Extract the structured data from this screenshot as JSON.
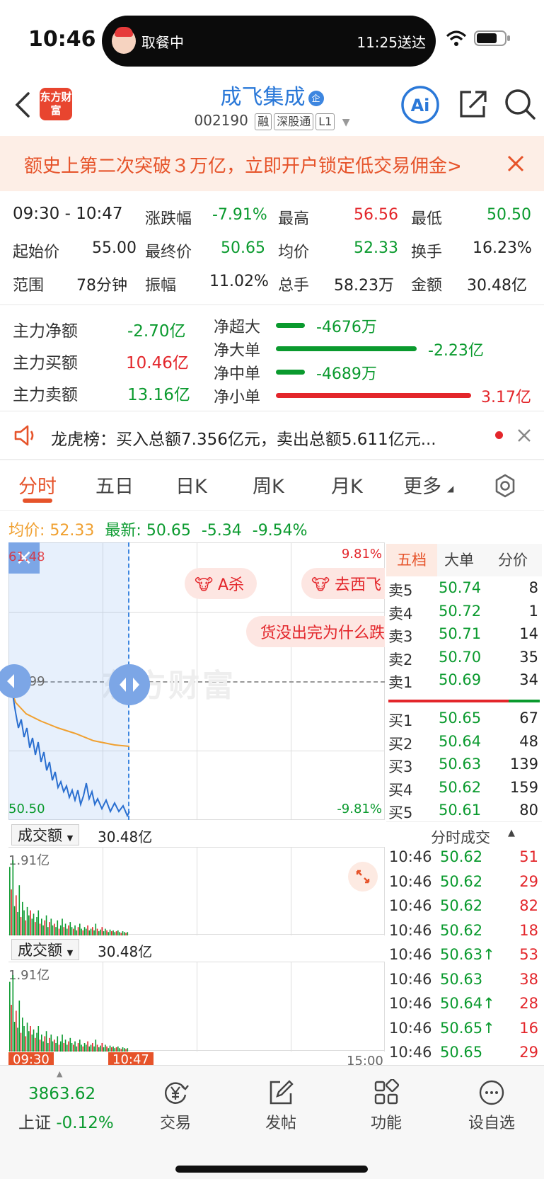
{
  "status_bar": {
    "time": "10:46",
    "island_left": "取餐中",
    "island_right": "11:25送达"
  },
  "header": {
    "logo_text": "东方财富",
    "title": "成飞集成",
    "title_badge": "企",
    "code": "002190",
    "tags": [
      "融",
      "深股通",
      "L1"
    ]
  },
  "banner": {
    "text": "额史上第二次突破３万亿，立即开户锁定低交易佣金>"
  },
  "stats": {
    "time_range": "09:30 - 10:47",
    "rows": [
      [
        {
          "label": "涨跌幅",
          "value": "-7.91%"
        },
        {
          "label": "最高",
          "value": "56.56"
        },
        {
          "label": "最低",
          "value": "50.50"
        }
      ],
      [
        {
          "label": "最终价",
          "value": "50.65"
        },
        {
          "label": "均价",
          "value": "52.33"
        },
        {
          "label": "换手",
          "value": "16.23%"
        }
      ],
      [
        {
          "label": "振幅",
          "value": "11.02%"
        },
        {
          "label": "总手",
          "value": "58.23万"
        },
        {
          "label": "金额",
          "value": "30.48亿"
        }
      ]
    ],
    "start_label": "起始价",
    "start_value": "55.00",
    "range_label": "范围",
    "range_value": "78分钟"
  },
  "capital": {
    "net_label": "主力净额",
    "net_value": "-2.70亿",
    "buy_label": "主力买额",
    "buy_value": "10.46亿",
    "sell_label": "主力卖额",
    "sell_value": "13.16亿",
    "flows": [
      {
        "label": "净超大",
        "value": "-4676万",
        "fraction": 0.15,
        "color": "#0a9a2e"
      },
      {
        "label": "净大单",
        "value": "-2.23亿",
        "fraction": 0.72,
        "color": "#0a9a2e"
      },
      {
        "label": "净中单",
        "value": "-4689万",
        "fraction": 0.15,
        "color": "#0a9a2e"
      },
      {
        "label": "净小单",
        "value": "3.17亿",
        "fraction": 1.0,
        "color": "#e3262b"
      }
    ]
  },
  "dragon_tiger": {
    "text": "龙虎榜：买入总额7.356亿元，卖出总额5.611亿元..."
  },
  "tabs": [
    "分时",
    "五日",
    "日K",
    "周K",
    "月K",
    "更多"
  ],
  "price_line": {
    "avg_label": "均价:",
    "avg_value": "52.33",
    "latest_label": "最新:",
    "latest_value": "50.65",
    "change": "-5.34",
    "change_pct": "-9.54%"
  },
  "chart": {
    "y_top": "61.48",
    "y_mid": "55.99",
    "y_bottom": "50.50",
    "pct_top": "9.81%",
    "pct_bottom": "-9.81%",
    "comments": [
      "A杀",
      "去西飞",
      "货没出完为什么跌"
    ],
    "watermark": "东方财富",
    "start_time": "09:30",
    "cursor_time": "10:47",
    "end_time": "15:00"
  },
  "volume_panels": [
    {
      "selector": "成交额",
      "total": "30.48亿",
      "max": "1.91亿"
    },
    {
      "selector": "成交额",
      "total": "30.48亿",
      "max": "1.91亿"
    }
  ],
  "orderbook": {
    "tabs": [
      "五档",
      "大单",
      "分价"
    ],
    "asks": [
      {
        "label": "卖5",
        "price": "50.74",
        "vol": "8"
      },
      {
        "label": "卖4",
        "price": "50.72",
        "vol": "1"
      },
      {
        "label": "卖3",
        "price": "50.71",
        "vol": "14"
      },
      {
        "label": "卖2",
        "price": "50.70",
        "vol": "35"
      },
      {
        "label": "卖1",
        "price": "50.69",
        "vol": "34"
      }
    ],
    "bids": [
      {
        "label": "买1",
        "price": "50.65",
        "vol": "67"
      },
      {
        "label": "买2",
        "price": "50.64",
        "vol": "48"
      },
      {
        "label": "买3",
        "price": "50.63",
        "vol": "139"
      },
      {
        "label": "买4",
        "price": "50.62",
        "vol": "159"
      },
      {
        "label": "买5",
        "price": "50.61",
        "vol": "80"
      }
    ],
    "ticks_title": "分时成交",
    "ticks": [
      {
        "time": "10:46",
        "price": "50.62",
        "vol": "51"
      },
      {
        "time": "10:46",
        "price": "50.62",
        "vol": "29"
      },
      {
        "time": "10:46",
        "price": "50.62",
        "vol": "82"
      },
      {
        "time": "10:46",
        "price": "50.62",
        "vol": "18"
      },
      {
        "time": "10:46",
        "price": "50.63↑",
        "vol": "53"
      },
      {
        "time": "10:46",
        "price": "50.63",
        "vol": "38"
      },
      {
        "time": "10:46",
        "price": "50.64↑",
        "vol": "28"
      },
      {
        "time": "10:46",
        "price": "50.65↑",
        "vol": "16"
      },
      {
        "time": "10:46",
        "price": "50.65",
        "vol": "29"
      }
    ]
  },
  "bottom_nav": {
    "index_value": "3863.62",
    "index_name": "上证",
    "index_change": "-0.12%",
    "items": [
      "交易",
      "发帖",
      "功能",
      "设自选"
    ]
  }
}
